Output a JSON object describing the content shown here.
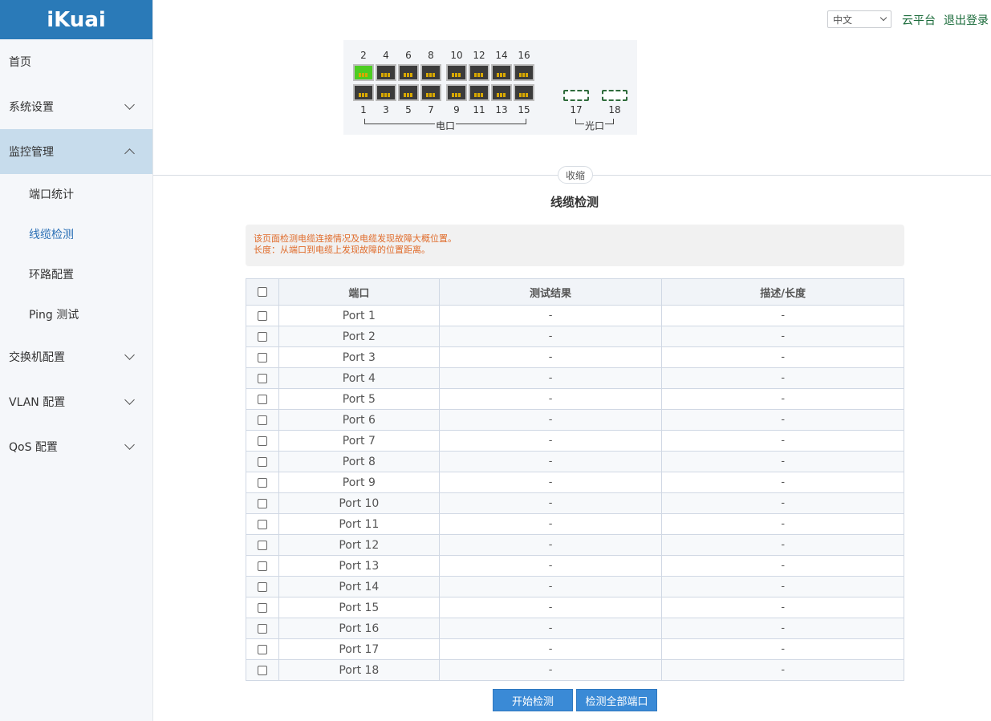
{
  "logo": "iKuai",
  "sidebar": {
    "items": [
      {
        "label": "首页"
      },
      {
        "label": "系统设置"
      },
      {
        "label": "监控管理"
      },
      {
        "label": "交换机配置"
      },
      {
        "label": "VLAN 配置"
      },
      {
        "label": "QoS 配置"
      }
    ],
    "sub_items": [
      {
        "label": "端口统计"
      },
      {
        "label": "线缆检测"
      },
      {
        "label": "环路配置"
      },
      {
        "label": "Ping 测试"
      }
    ]
  },
  "header": {
    "language": "中文",
    "cloud": "云平台",
    "logout": "退出登录"
  },
  "switch_panel": {
    "top_ports": [
      "2",
      "4",
      "6",
      "8",
      "10",
      "12",
      "14",
      "16"
    ],
    "bottom_ports": [
      "1",
      "3",
      "5",
      "7",
      "9",
      "11",
      "13",
      "15"
    ],
    "sfp_ports": [
      "17",
      "18"
    ],
    "electric_label": "电口",
    "optical_label": "光口",
    "link_up_ports": [
      "2"
    ]
  },
  "collapse_label": "收缩",
  "title": "线缆检测",
  "info": {
    "line1": "该页面检测电缆连接情况及电缆发现故障大概位置。",
    "line2": "长度：从端口到电缆上发现故障的位置距离。"
  },
  "table": {
    "headers": {
      "port": "端口",
      "result": "测试结果",
      "desc": "描述/长度"
    },
    "rows": [
      {
        "port": "Port 1",
        "result": "-",
        "desc": "-"
      },
      {
        "port": "Port 2",
        "result": "-",
        "desc": "-"
      },
      {
        "port": "Port 3",
        "result": "-",
        "desc": "-"
      },
      {
        "port": "Port 4",
        "result": "-",
        "desc": "-"
      },
      {
        "port": "Port 5",
        "result": "-",
        "desc": "-"
      },
      {
        "port": "Port 6",
        "result": "-",
        "desc": "-"
      },
      {
        "port": "Port 7",
        "result": "-",
        "desc": "-"
      },
      {
        "port": "Port 8",
        "result": "-",
        "desc": "-"
      },
      {
        "port": "Port 9",
        "result": "-",
        "desc": "-"
      },
      {
        "port": "Port 10",
        "result": "-",
        "desc": "-"
      },
      {
        "port": "Port 11",
        "result": "-",
        "desc": "-"
      },
      {
        "port": "Port 12",
        "result": "-",
        "desc": "-"
      },
      {
        "port": "Port 13",
        "result": "-",
        "desc": "-"
      },
      {
        "port": "Port 14",
        "result": "-",
        "desc": "-"
      },
      {
        "port": "Port 15",
        "result": "-",
        "desc": "-"
      },
      {
        "port": "Port 16",
        "result": "-",
        "desc": "-"
      },
      {
        "port": "Port 17",
        "result": "-",
        "desc": "-"
      },
      {
        "port": "Port 18",
        "result": "-",
        "desc": "-"
      }
    ]
  },
  "buttons": {
    "start": "开始检测",
    "check_all": "检测全部端口"
  },
  "colors": {
    "brand": "#2a7ab8",
    "active_nav": "#c7dcec",
    "link_up": "#4ccd21",
    "notice": "#e06b2a",
    "button": "#3a8ad6"
  }
}
